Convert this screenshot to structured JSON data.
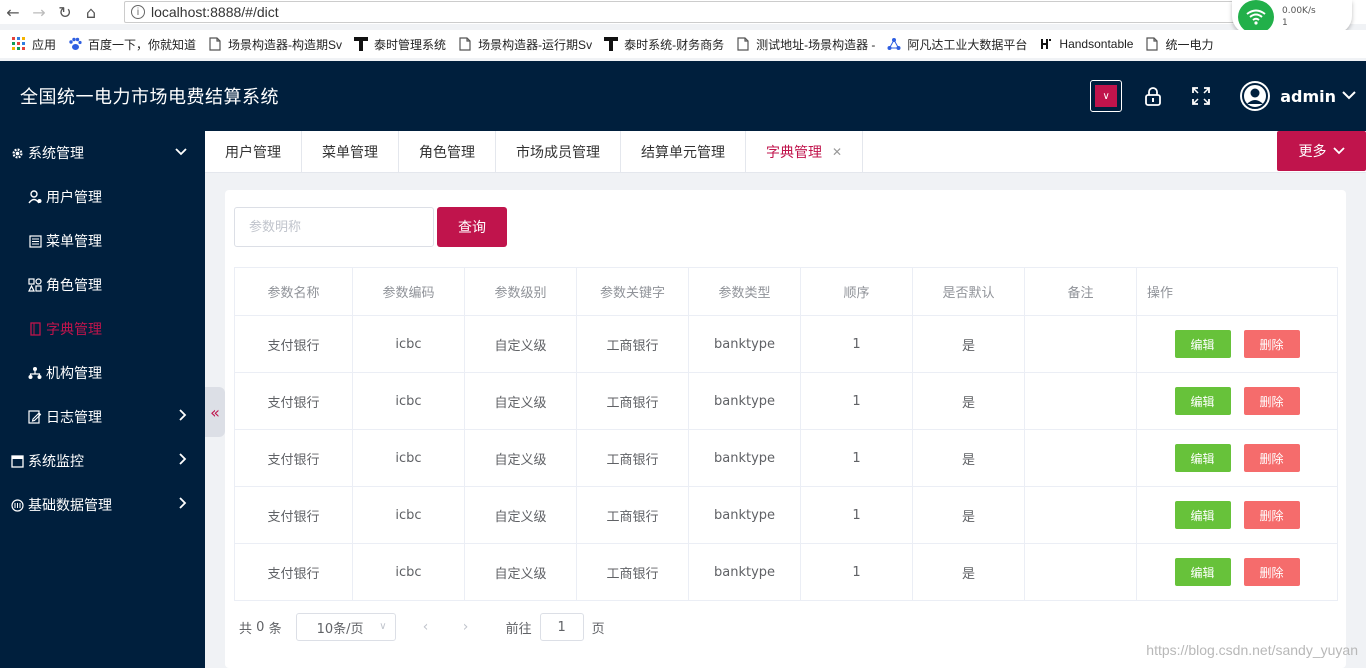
{
  "browser": {
    "url": "localhost:8888/#/dict",
    "net_speed": "0.00K/s",
    "net_count": "1",
    "bookmarks": [
      {
        "label": "应用",
        "icon": "apps-grid-icon"
      },
      {
        "label": "百度一下，你就知道",
        "icon": "baidu-paw-icon"
      },
      {
        "label": "场景构造器-构造期Sv",
        "icon": "page-icon"
      },
      {
        "label": "泰时管理系统",
        "icon": "t-logo-icon"
      },
      {
        "label": "场景构造器-运行期Sv",
        "icon": "page-icon"
      },
      {
        "label": "泰时系统-财务商务",
        "icon": "t-logo-icon"
      },
      {
        "label": "测试地址-场景构造器 -",
        "icon": "page-icon"
      },
      {
        "label": "阿凡达工业大数据平台",
        "icon": "avatar-logo-icon"
      },
      {
        "label": "Handsontable",
        "icon": "handsontable-icon"
      },
      {
        "label": "统一电力",
        "icon": "page-icon"
      }
    ]
  },
  "header": {
    "title": "全国统一电力市场电费结算系统",
    "username": "admin",
    "accent_color": "#c0144c",
    "bg_color": "#001f3d"
  },
  "sidebar": {
    "items": [
      {
        "label": "系统管理",
        "level": "top",
        "icon": "gear-icon",
        "arrow": "chevron-down"
      },
      {
        "label": "用户管理",
        "level": "sub",
        "icon": "user-icon"
      },
      {
        "label": "菜单管理",
        "level": "sub",
        "icon": "list-icon"
      },
      {
        "label": "角色管理",
        "level": "sub",
        "icon": "role-icon"
      },
      {
        "label": "字典管理",
        "level": "sub",
        "icon": "book-icon",
        "active": true
      },
      {
        "label": "机构管理",
        "level": "sub",
        "icon": "org-tree-icon"
      },
      {
        "label": "日志管理",
        "level": "sub",
        "icon": "edit-doc-icon",
        "arrow": "chevron-right"
      },
      {
        "label": "系统监控",
        "level": "top",
        "icon": "monitor-icon",
        "arrow": "chevron-right"
      },
      {
        "label": "基础数据管理",
        "level": "top",
        "icon": "database-icon",
        "arrow": "chevron-right"
      }
    ]
  },
  "tabs": [
    {
      "label": "用户管理"
    },
    {
      "label": "菜单管理"
    },
    {
      "label": "角色管理"
    },
    {
      "label": "市场成员管理"
    },
    {
      "label": "结算单元管理"
    },
    {
      "label": "字典管理",
      "active": true
    }
  ],
  "more_label": "更多",
  "search": {
    "placeholder": "参数明称",
    "value": "",
    "button": "查询"
  },
  "table": {
    "headers": [
      "参数名称",
      "参数编码",
      "参数级别",
      "参数关键字",
      "参数类型",
      "顺序",
      "是否默认",
      "备注",
      "操作"
    ],
    "rows": [
      [
        "支付银行",
        "icbc",
        "自定义级",
        "工商银行",
        "banktype",
        "1",
        "是",
        ""
      ],
      [
        "支付银行",
        "icbc",
        "自定义级",
        "工商银行",
        "banktype",
        "1",
        "是",
        ""
      ],
      [
        "支付银行",
        "icbc",
        "自定义级",
        "工商银行",
        "banktype",
        "1",
        "是",
        ""
      ],
      [
        "支付银行",
        "icbc",
        "自定义级",
        "工商银行",
        "banktype",
        "1",
        "是",
        ""
      ],
      [
        "支付银行",
        "icbc",
        "自定义级",
        "工商银行",
        "banktype",
        "1",
        "是",
        ""
      ]
    ],
    "edit_label": "编辑",
    "delete_label": "删除"
  },
  "pagination": {
    "total_prefix": "共",
    "total": "0",
    "total_suffix": "条",
    "page_size": "10条/页",
    "goto_prefix": "前往",
    "current_page": "1",
    "goto_suffix": "页"
  },
  "watermark": "https://blog.csdn.net/sandy_yuyan"
}
